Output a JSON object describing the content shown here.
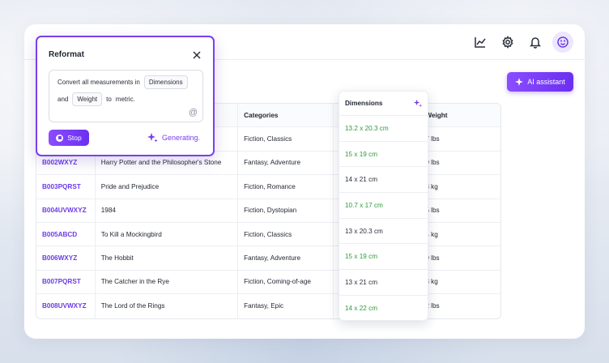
{
  "topbar": {
    "icons": [
      "chart-icon",
      "gear-icon",
      "bell-icon",
      "smiley-avatar-icon"
    ]
  },
  "ai_button": {
    "label": "AI assistant",
    "icon": "sparkle-icon"
  },
  "popup": {
    "title": "Reformat",
    "text1": "Convert all measurements in",
    "chip1": "Dimensions",
    "text2": "and",
    "chip2": "Weight",
    "text3": "to",
    "text4": "metric.",
    "at": "@",
    "stop_label": "Stop",
    "status": "Generating."
  },
  "table": {
    "headers": [
      "",
      "",
      "Categories",
      "",
      "Weight"
    ],
    "rows": [
      {
        "asin": "",
        "title": "",
        "category": "Fiction, Classics",
        "weight": "7 lbs"
      },
      {
        "asin": "B002WXYZ",
        "title": "Harry Potter and the Philosopher's Stone",
        "category": "Fantasy, Adventure",
        "weight": "9 lbs"
      },
      {
        "asin": "B003PQRST",
        "title": "Pride and Prejudice",
        "category": "Fiction, Romance",
        "weight": "3 kg"
      },
      {
        "asin": "B004UVWXYZ",
        "title": "1984",
        "category": "Fiction, Dystopian",
        "weight": "5 lbs"
      },
      {
        "asin": "B005ABCD",
        "title": "To Kill a Mockingbird",
        "category": "Fiction, Classics",
        "weight": "4 kg"
      },
      {
        "asin": "B006WXYZ",
        "title": "The Hobbit",
        "category": "Fantasy, Adventure",
        "weight": "9 lbs"
      },
      {
        "asin": "B007PQRST",
        "title": "The Catcher in the Rye",
        "category": "Fiction, Coming-of-age",
        "weight": "3 kg"
      },
      {
        "asin": "B008UVWXYZ",
        "title": "The Lord of the Rings",
        "category": "Fantasy, Epic",
        "weight": "2 lbs"
      }
    ]
  },
  "dimensions": {
    "header": "Dimensions",
    "cells": [
      {
        "value": "13.2 x 20.3 cm",
        "status": "updated"
      },
      {
        "value": "15 x 19 cm",
        "status": "updated"
      },
      {
        "value": "14 x 21 cm",
        "status": "unchanged"
      },
      {
        "value": "10.7 x 17 cm",
        "status": "updated"
      },
      {
        "value": "13 x 20.3 cm",
        "status": "unchanged"
      },
      {
        "value": "15 x 19 cm",
        "status": "updated"
      },
      {
        "value": "13 x 21 cm",
        "status": "unchanged"
      },
      {
        "value": "14 x 22 cm",
        "status": "updated"
      }
    ],
    "colors": {
      "updated": "#2f9a3a",
      "unchanged": "#2a2f3a"
    }
  },
  "colors": {
    "accent": "#7a3ff0",
    "link": "#6b3ce6"
  }
}
